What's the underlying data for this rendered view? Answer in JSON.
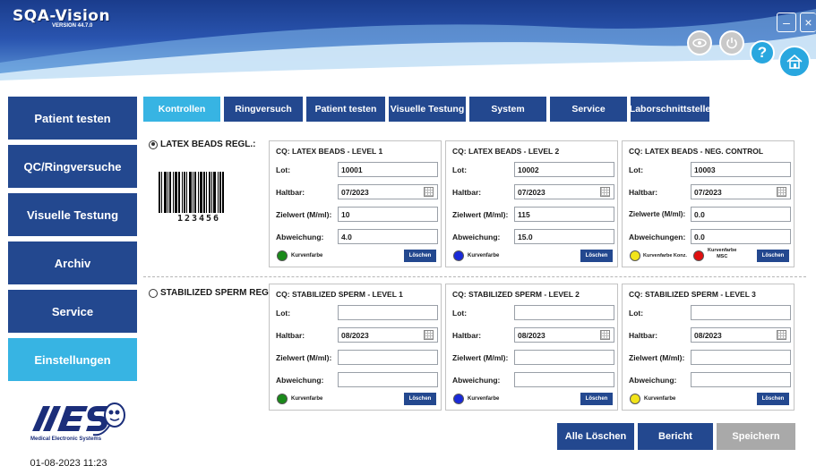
{
  "app": {
    "title": "SQA-Vision",
    "version": "VERSION 44.7.0",
    "datetime": "01-08-2023 11:23",
    "company_tagline": "Medical Electronic Systems"
  },
  "colors": {
    "nav_dark": "#23488f",
    "nav_active": "#37b4e3",
    "help_blue": "#29a7df",
    "disabled_gray": "#a9a9a9"
  },
  "header": {
    "icons": [
      "minimize-icon",
      "close-icon",
      "eye-icon",
      "power-icon",
      "help-icon",
      "home-icon"
    ],
    "help_symbol": "?"
  },
  "sidebar": {
    "items": [
      {
        "label": "Patient testen",
        "active": false
      },
      {
        "label": "QC/Ringversuche",
        "active": false
      },
      {
        "label": "Visuelle Testung",
        "active": false
      },
      {
        "label": "Archiv",
        "active": false
      },
      {
        "label": "Service",
        "active": false
      },
      {
        "label": "Einstellungen",
        "active": true
      }
    ]
  },
  "tabs": [
    {
      "label": "Kontrollen",
      "active": true
    },
    {
      "label": "Ringversuch",
      "active": false
    },
    {
      "label": "Patient testen",
      "active": false
    },
    {
      "label": "Visuelle Testung",
      "active": false
    },
    {
      "label": "System",
      "active": false
    },
    {
      "label": "Service",
      "active": false
    },
    {
      "label": "Laborschnittstelle",
      "active": false
    }
  ],
  "latex": {
    "radio_label": "LATEX BEADS REGL.:",
    "selected": true,
    "barcode_number": "123456",
    "cards": [
      {
        "title": "CQ: LATEX BEADS - LEVEL 1",
        "lot_label": "Lot:",
        "lot": "10001",
        "haltbar_label": "Haltbar:",
        "haltbar": "07/2023",
        "target_label": "Zielwert (M/ml):",
        "target": "10",
        "dev_label": "Abweichung:",
        "dev": "4.0",
        "color_label": "Kurvenfarbe",
        "dot_color": "#1a8a1a",
        "delete_label": "Löschen"
      },
      {
        "title": "CQ: LATEX BEADS - LEVEL 2",
        "lot_label": "Lot:",
        "lot": "10002",
        "haltbar_label": "Haltbar:",
        "haltbar": "07/2023",
        "target_label": "Zielwert (M/ml):",
        "target": "115",
        "dev_label": "Abweichung:",
        "dev": "15.0",
        "color_label": "Kurvenfarbe",
        "dot_color": "#1a2ad8",
        "delete_label": "Löschen"
      },
      {
        "title": "CQ: LATEX BEADS - NEG. CONTROL",
        "lot_label": "Lot:",
        "lot": "10003",
        "haltbar_label": "Haltbar:",
        "haltbar": "07/2023",
        "target_label": "Zielwerte (M/ml):",
        "target": "0.0",
        "dev_label": "Abweichungen:",
        "dev": "0.0",
        "color_label": "Kurvenfarbe Konz.",
        "dot_color": "#f2e41a",
        "color_label2_line1": "Kurvenfarbe",
        "color_label2_line2": "MSC",
        "dot_color2": "#e01010",
        "delete_label": "Löschen"
      }
    ]
  },
  "sperm": {
    "radio_label": "STABILIZED SPERM REGL.:",
    "selected": false,
    "cards": [
      {
        "title": "CQ: STABILIZED SPERM - LEVEL 1",
        "lot_label": "Lot:",
        "lot": "",
        "haltbar_label": "Haltbar:",
        "haltbar": "08/2023",
        "target_label": "Zielwert (M/ml):",
        "target": "",
        "dev_label": "Abweichung:",
        "dev": "",
        "color_label": "Kurvenfarbe",
        "dot_color": "#1a8a1a",
        "delete_label": "Löschen"
      },
      {
        "title": "CQ: STABILIZED SPERM - LEVEL 2",
        "lot_label": "Lot:",
        "lot": "",
        "haltbar_label": "Haltbar:",
        "haltbar": "08/2023",
        "target_label": "Zielwert (M/ml):",
        "target": "",
        "dev_label": "Abweichung:",
        "dev": "",
        "color_label": "Kurvenfarbe",
        "dot_color": "#1a2ad8",
        "delete_label": "Löschen"
      },
      {
        "title": "CQ: STABILIZED SPERM - LEVEL 3",
        "lot_label": "Lot:",
        "lot": "",
        "haltbar_label": "Haltbar:",
        "haltbar": "08/2023",
        "target_label": "Zielwert (M/ml):",
        "target": "",
        "dev_label": "Abweichung:",
        "dev": "",
        "color_label": "Kurvenfarbe",
        "dot_color": "#f2e41a",
        "delete_label": "Löschen"
      }
    ]
  },
  "actions": {
    "clear_all": "Alle Löschen",
    "report": "Bericht",
    "save": "Speichern",
    "save_enabled": false
  }
}
